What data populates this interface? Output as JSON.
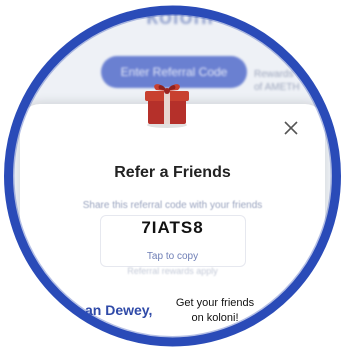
{
  "background": {
    "logo": "koloni",
    "enter_referral_button": "Enter Referral Code",
    "side_text_line1": "Rewards",
    "side_text_line2": "of AMETH",
    "greeting_name": "an Dewey,"
  },
  "modal": {
    "title": "Refer a Friends",
    "hint": "Share this referral code with your friends",
    "referral_code": "7IATS8",
    "copy_label": "Tap to copy",
    "under_copy": "Referral rewards apply",
    "friends_text_line1": "Get your friends",
    "friends_text_line2": "on koloni!"
  },
  "icons": {
    "gift": "gift-icon",
    "close": "close-icon"
  },
  "colors": {
    "frame_blue": "#2a4bb8",
    "accent_blue": "#4a64c9",
    "gift_red": "#b5302a"
  }
}
